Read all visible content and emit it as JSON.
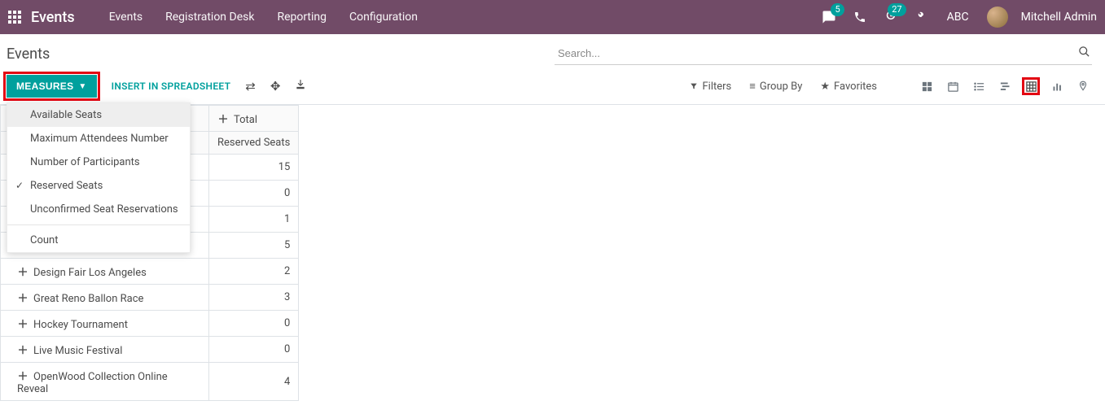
{
  "nav": {
    "brand": "Events",
    "items": [
      "Events",
      "Registration Desk",
      "Reporting",
      "Configuration"
    ],
    "msg_badge": "5",
    "activity_badge": "27",
    "abc": "ABC",
    "user": "Mitchell Admin"
  },
  "breadcrumb": {
    "title": "Events"
  },
  "search": {
    "placeholder": "Search..."
  },
  "toolbar": {
    "measures_label": "MEASURES",
    "insert_label": "INSERT IN SPREADSHEET",
    "filters": "Filters",
    "groupby": "Group By",
    "favorites": "Favorites"
  },
  "dropdown": {
    "items": [
      {
        "label": "Available Seats",
        "checked": false,
        "hover": true
      },
      {
        "label": "Maximum Attendees Number",
        "checked": false
      },
      {
        "label": "Number of Participants",
        "checked": false
      },
      {
        "label": "Reserved Seats",
        "checked": true
      },
      {
        "label": "Unconfirmed Seat Reservations",
        "checked": false
      }
    ],
    "count_label": "Count"
  },
  "pivot": {
    "total_label": "Total",
    "col_header": "Reserved Seats",
    "rows": [
      {
        "name": "",
        "value": 15
      },
      {
        "name": "",
        "value": 0
      },
      {
        "name": "",
        "value": 1
      },
      {
        "name": "",
        "value": 5
      },
      {
        "name": "Design Fair Los Angeles",
        "value": 2
      },
      {
        "name": "Great Reno Ballon Race",
        "value": 3
      },
      {
        "name": "Hockey Tournament",
        "value": 0
      },
      {
        "name": "Live Music Festival",
        "value": 0
      },
      {
        "name": "OpenWood Collection Online Reveal",
        "value": 4
      }
    ]
  }
}
